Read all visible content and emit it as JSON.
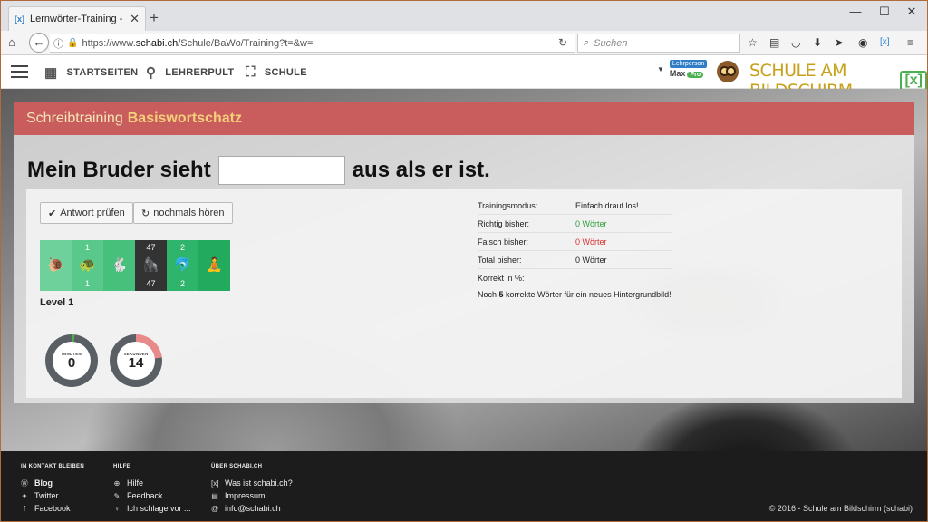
{
  "browser": {
    "tab_title": "Lernwörter-Training - Schule",
    "tab_favicon": "[x]",
    "url_prefix": "https://www.",
    "url_domain": "schabi.ch",
    "url_rest": "/Schule/BaWo/Training?t=&w=",
    "search_placeholder": "Suchen"
  },
  "site_nav": {
    "items": [
      {
        "label": "STARTSEITEN",
        "icon": "calendar-icon"
      },
      {
        "label": "LEHRERPULT",
        "icon": "desk-lamp-icon"
      },
      {
        "label": "SCHULE",
        "icon": "chart-icon"
      }
    ],
    "user_role": "Lehrperson",
    "user_name": "Max",
    "user_tier": "Pro",
    "logo_text": "SCHULE AM BILDSCHIRM",
    "logo_mark": "[x]"
  },
  "card": {
    "title_prefix": "Schreibtraining",
    "title_main": "Basiswortschatz",
    "sentence_before": "Mein Bruder sieht",
    "sentence_after": "aus als er ist.",
    "buttons": {
      "check": "Antwort prüfen",
      "replay": "nochmals hören"
    },
    "levels": [
      {
        "icon": "snail-icon",
        "top": "",
        "bottom": "",
        "color": "#6ed09a"
      },
      {
        "icon": "turtle-icon",
        "top": "1",
        "bottom": "1",
        "color": "#58c98a"
      },
      {
        "icon": "rabbit-icon",
        "top": "",
        "bottom": "",
        "color": "#47c07c"
      },
      {
        "icon": "gorilla-icon",
        "top": "47",
        "bottom": "47",
        "color": "#333333"
      },
      {
        "icon": "dolphin-icon",
        "top": "2",
        "bottom": "2",
        "color": "#2fb46b"
      },
      {
        "icon": "meditation-icon",
        "top": "",
        "bottom": "",
        "color": "#22aa5f"
      }
    ],
    "level_label": "Level 1",
    "timers": [
      {
        "caption": "MINUTEN",
        "value": "0",
        "progress": 0.02,
        "accent": "#4caf50"
      },
      {
        "caption": "SEKUNDEN",
        "value": "14",
        "progress": 0.23,
        "accent": "#e88a8a"
      }
    ],
    "stats": [
      {
        "key": "Trainingsmodus:",
        "value": "Einfach drauf los!",
        "color": "#222222"
      },
      {
        "key": "Richtig bisher:",
        "value": "0 Wörter",
        "color": "#2e9e3a"
      },
      {
        "key": "Falsch bisher:",
        "value": "0 Wörter",
        "color": "#d93030"
      },
      {
        "key": "Total bisher:",
        "value": "0 Wörter",
        "color": "#222222"
      },
      {
        "key": "Korrekt in %:",
        "value": "",
        "color": "#222222"
      }
    ],
    "hint_before": "Noch ",
    "hint_count": "5",
    "hint_after": " korrekte Wörter für ein neues Hintergrundbild!"
  },
  "footer": {
    "col1": {
      "title": "IN KONTAKT BLEIBEN",
      "items": [
        "Blog",
        "Twitter",
        "Facebook"
      ]
    },
    "col2": {
      "title": "HILFE",
      "items": [
        "Hilfe",
        "Feedback",
        "Ich schlage vor ..."
      ]
    },
    "col3": {
      "title": "ÜBER SCHABI.CH",
      "items": [
        "Was ist schabi.ch?",
        "Impressum",
        "info@schabi.ch"
      ]
    },
    "copyright": "© 2016 - Schule am Bildschirm (schabi)"
  }
}
